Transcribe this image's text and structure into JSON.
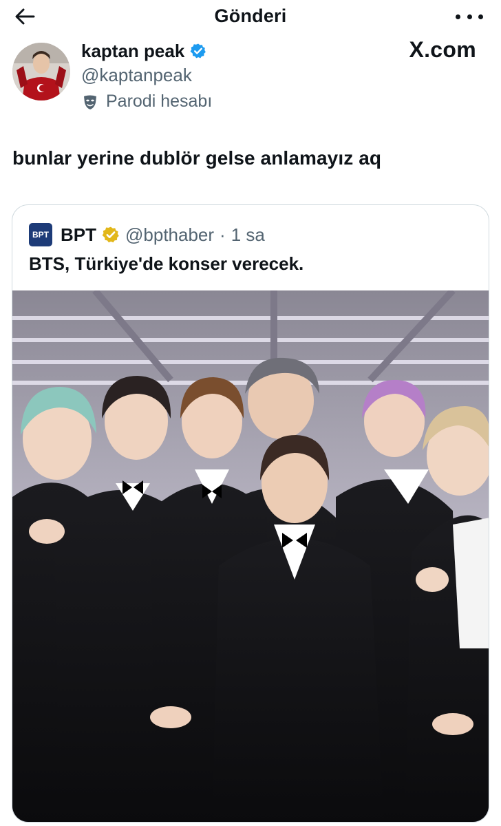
{
  "header": {
    "title": "Gönderi"
  },
  "author": {
    "name": "kaptan peak",
    "handle": "@kaptanpeak",
    "label": "Parodi hesabı"
  },
  "source": "X.com",
  "tweet": {
    "text": "bunlar yerine dublör gelse anlamayız aq"
  },
  "quote": {
    "logo_text": "BPT",
    "name": "BPT",
    "handle": "@bpthaber",
    "separator": "·",
    "time": "1 sa",
    "text": "BTS, Türkiye'de konser verecek."
  },
  "colors": {
    "text": "#0f1419",
    "secondary": "#536471",
    "verified_blue": "#1d9bf0",
    "verified_gold": "#e2b719",
    "border": "#cfd9de"
  }
}
